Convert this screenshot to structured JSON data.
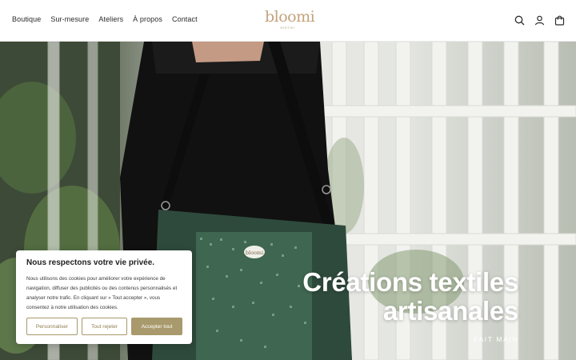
{
  "nav": {
    "items": [
      "Boutique",
      "Sur-mesure",
      "Ateliers",
      "À propos",
      "Contact"
    ]
  },
  "logo": {
    "text": "bloomi",
    "subtext": "atelier"
  },
  "header_icons": [
    "search-icon",
    "account-icon",
    "cart-icon"
  ],
  "hero": {
    "title_line1": "Créations textiles",
    "title_line2": "artisanales",
    "tagline": "FAIT MAIN",
    "bag_label": "bloomi"
  },
  "cookie": {
    "title": "Nous respectons votre vie privée.",
    "body": "Nous utilisons des cookies pour améliorer votre expérience de navigation, diffuser des publicités ou des contenus personnalisés et analyser notre trafic. En cliquant sur « Tout accepter », vous consentez à notre utilisation des cookies.",
    "customize": "Personnaliser",
    "reject": "Tout rejeter",
    "accept": "Accepter tout"
  },
  "colors": {
    "accent": "#a89a6c",
    "logo": "#c3a37c",
    "fabric": "#2e4a3c"
  }
}
